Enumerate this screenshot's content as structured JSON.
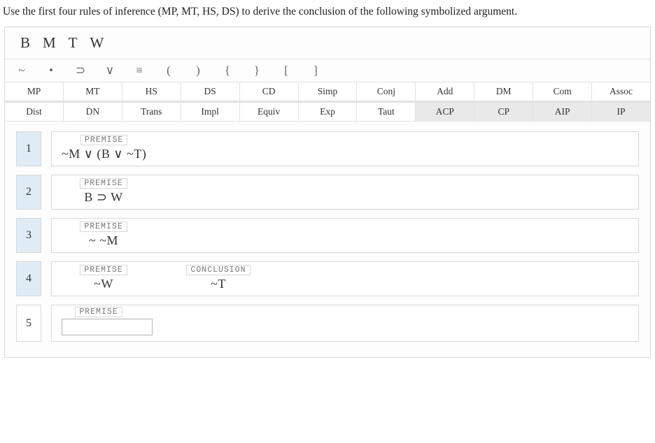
{
  "instruction": "Use the first four rules of inference (MP, MT, HS, DS) to derive the conclusion of the following symbolized argument.",
  "variables": [
    "B",
    "M",
    "T",
    "W"
  ],
  "symbols": [
    "~",
    "•",
    "⊃",
    "∨",
    "≡",
    "(",
    ")",
    "{",
    "}",
    "[",
    "]"
  ],
  "rules_row1": [
    "MP",
    "MT",
    "HS",
    "DS",
    "CD",
    "Simp",
    "Conj",
    "Add",
    "DM",
    "Com",
    "Assoc"
  ],
  "rules_row2": [
    "Dist",
    "DN",
    "Trans",
    "Impl",
    "Equiv",
    "Exp",
    "Taut",
    "ACP",
    "CP",
    "AIP",
    "IP"
  ],
  "rules_row2_shaded": [
    "ACP",
    "CP",
    "AIP",
    "IP"
  ],
  "tags": {
    "premise": "PREMISE",
    "conclusion": "CONCLUSION"
  },
  "lines": {
    "l1": {
      "num": "1",
      "premise": "~M ∨ (B ∨ ~T)"
    },
    "l2": {
      "num": "2",
      "premise": "B ⊃ W"
    },
    "l3": {
      "num": "3",
      "premise": "~ ~M"
    },
    "l4": {
      "num": "4",
      "premise": "~W",
      "conclusion": "~T"
    },
    "l5": {
      "num": "5"
    }
  }
}
